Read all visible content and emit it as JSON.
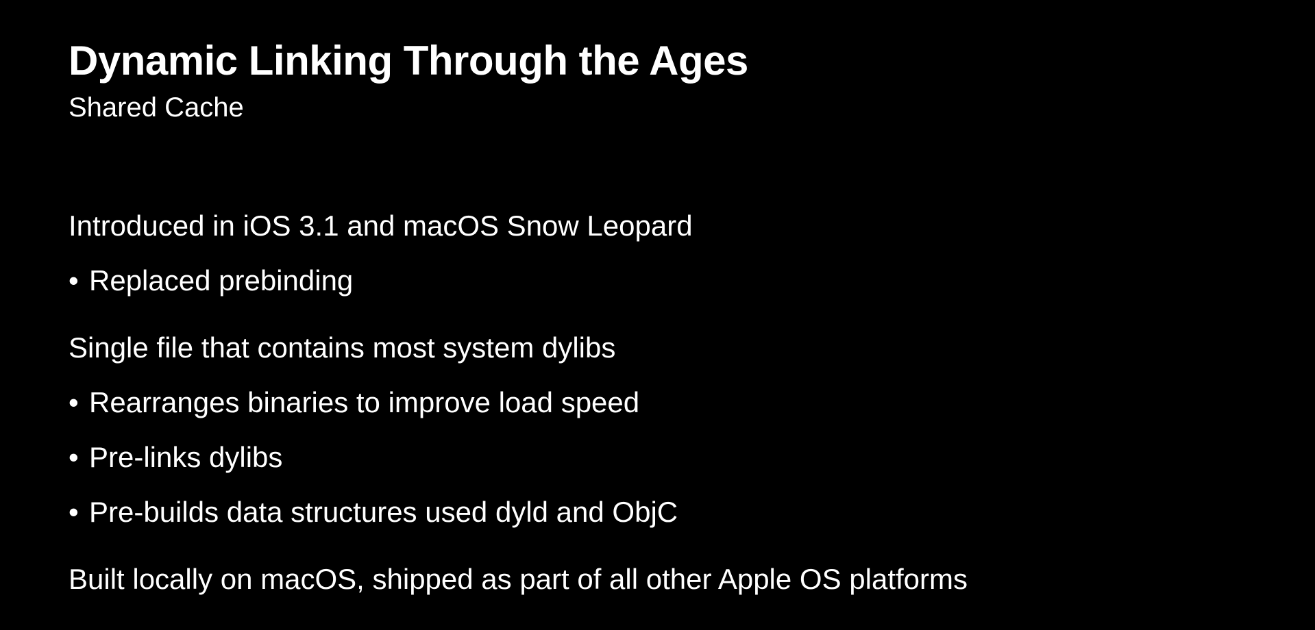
{
  "slide": {
    "title": "Dynamic Linking Through the Ages",
    "subtitle": "Shared Cache",
    "bullet_glyph": "•",
    "sections": [
      {
        "heading": "Introduced in iOS 3.1 and macOS Snow Leopard",
        "bullets": [
          "Replaced prebinding"
        ]
      },
      {
        "heading": "Single file that contains most system dylibs",
        "bullets": [
          "Rearranges binaries to improve load speed",
          "Pre-links dylibs",
          "Pre-builds data structures used dyld and ObjC"
        ]
      },
      {
        "heading": "Built locally on macOS, shipped as part of all other Apple OS platforms",
        "bullets": []
      }
    ],
    "colors": {
      "background": "#000000",
      "text": "#ffffff"
    }
  }
}
